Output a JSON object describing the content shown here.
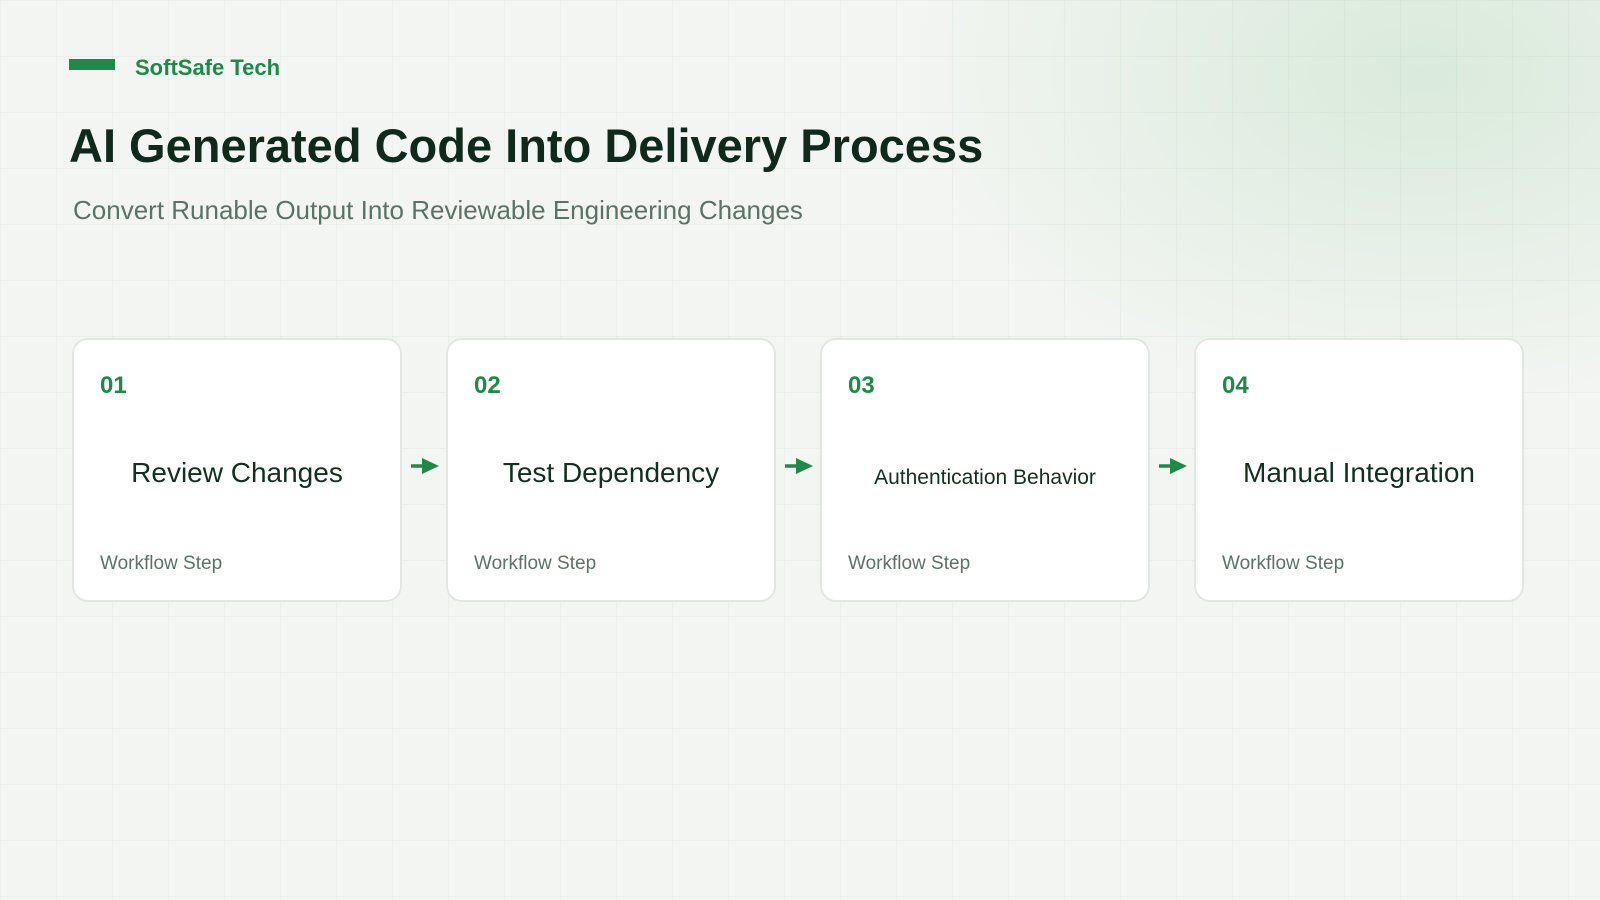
{
  "brand": {
    "name": "SoftSafe Tech",
    "accent_color": "#1f8a48"
  },
  "header": {
    "title": "AI Generated Code Into Delivery Process",
    "subtitle": "Convert Runable Output Into Reviewable Engineering Changes"
  },
  "steps": [
    {
      "number": "01",
      "title": "Review Changes",
      "caption": "Workflow Step"
    },
    {
      "number": "02",
      "title": "Test Dependency",
      "caption": "Workflow Step"
    },
    {
      "number": "03",
      "title": "Authentication Behavior",
      "caption": "Workflow Step"
    },
    {
      "number": "04",
      "title": "Manual Integration",
      "caption": "Workflow Step"
    }
  ],
  "connector_icon": "arrow-right-icon"
}
